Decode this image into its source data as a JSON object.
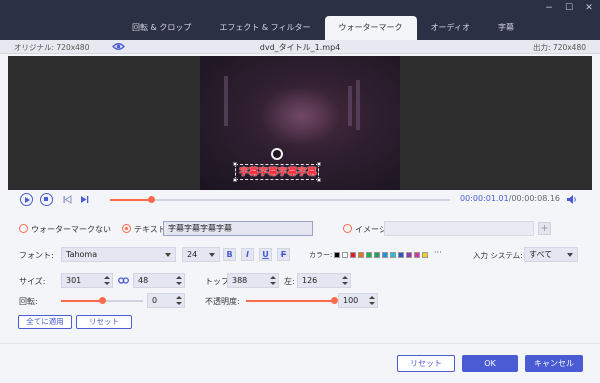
{
  "window": {
    "controls": [
      "−",
      "☐",
      "✕"
    ]
  },
  "tabs": [
    {
      "label": "回転 & クロップ",
      "active": false
    },
    {
      "label": "エフェクト & フィルター",
      "active": false
    },
    {
      "label": "ウォーターマーク",
      "active": true
    },
    {
      "label": "オーディオ",
      "active": false
    },
    {
      "label": "字幕",
      "active": false
    }
  ],
  "info": {
    "original_label": "オリジナル: 720x480",
    "file_name": "dvd_タイトル_1.mp4",
    "output_label": "出力: 720x480"
  },
  "preview": {
    "watermark_text": "字幕字幕字幕字幕",
    "watermark_color": "#ff2a3a"
  },
  "playback": {
    "current_time": "00:00:01.01",
    "total_time": "/00:00:08.16",
    "progress": 0.12
  },
  "watermark": {
    "none_label": "ウォーターマークない",
    "text_label": "テキスト",
    "text_value": "字幕字幕字幕字幕",
    "image_label": "イメージ",
    "selected": "text"
  },
  "font": {
    "label": "フォント:",
    "family": "Tahoma",
    "size": "24",
    "bold": "B",
    "italic": "I",
    "underline": "U",
    "strike": "F",
    "color_label": "カラー:",
    "colors": [
      "#000000",
      "#ffffff",
      "#e02020",
      "#f07020",
      "#20b050",
      "#20a060",
      "#2090e0",
      "#20c0d0",
      "#3050d0",
      "#a030c0",
      "#e030a0",
      "#f0d020"
    ],
    "more": "···",
    "input_system_label": "入力 システム:",
    "input_system_value": "すべて"
  },
  "size": {
    "label": "サイズ:",
    "width": "301",
    "height": "48",
    "top_label": "トップ:",
    "top": "388",
    "left_label": "左:",
    "left": "126"
  },
  "rotation": {
    "label": "回転:",
    "value": "0",
    "fraction": 0.5
  },
  "opacity": {
    "label": "不透明度:",
    "value": "100",
    "fraction": 1.0
  },
  "actions": {
    "apply_all": "全てに適用",
    "reset": "リセット"
  },
  "footer": {
    "reset": "リセット",
    "ok": "OK",
    "cancel": "キャンセル"
  }
}
